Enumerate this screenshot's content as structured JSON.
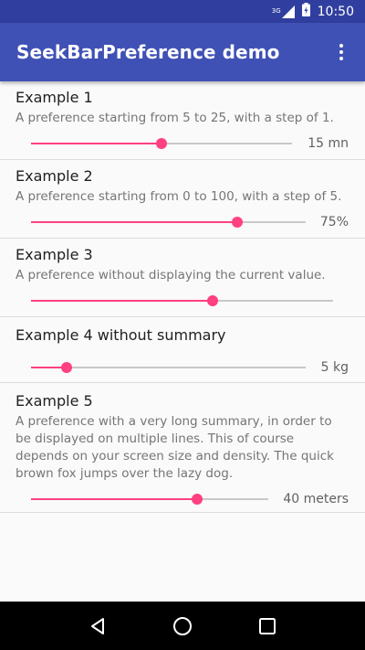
{
  "status_bar": {
    "time": "10:50",
    "network": "3G"
  },
  "app_bar": {
    "title": "SeekBarPreference demo"
  },
  "preferences": [
    {
      "title": "Example 1",
      "summary": "A preference starting from 5 to 25, with a step of 1.",
      "value_label": "15 mn",
      "fraction": 0.5
    },
    {
      "title": "Example 2",
      "summary": "A preference starting from 0 to 100, with a step of 5.",
      "value_label": "75%",
      "fraction": 0.75
    },
    {
      "title": "Example 3",
      "summary": "A preference without displaying the current value.",
      "fraction": 0.6
    },
    {
      "title": "Example 4 without summary",
      "value_label": "5 kg",
      "fraction": 0.13
    },
    {
      "title": "Example 5",
      "summary": "A preference with a very long summary, in order to be displayed on multiple lines. This of course depends on your screen size and density. The quick brown fox jumps over the lazy dog.",
      "value_label": "40 meters",
      "fraction": 0.7
    }
  ],
  "colors": {
    "primary": "#3f51b5",
    "primary_dark": "#303f9f",
    "accent": "#ff4081"
  }
}
